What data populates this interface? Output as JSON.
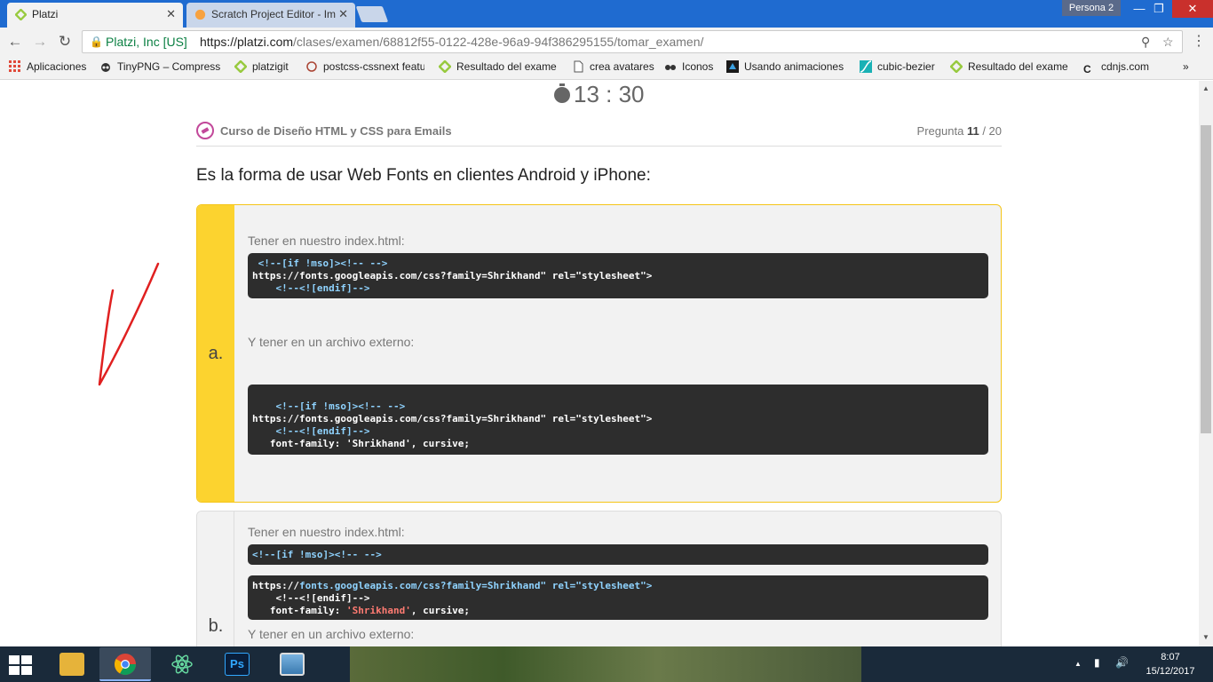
{
  "browser": {
    "tabs": [
      {
        "title": "Platzi",
        "active": true
      },
      {
        "title": "Scratch Project Editor - Im",
        "active": false
      }
    ],
    "profile_label": "Persona 2",
    "window_controls": {
      "minimize": "—",
      "maximize": "❐",
      "close": "✕"
    },
    "nav": {
      "back": "←",
      "forward": "→",
      "reload": "↻"
    },
    "omnibox": {
      "secure_label": "Platzi, Inc [US]",
      "url_host": "https://platzi.com",
      "url_path": "/clases/examen/68812f55-0122-428e-96a9-94f386295155/tomar_examen/"
    },
    "bookmarks": [
      {
        "label": "Aplicaciones",
        "icon": "apps-grid-icon"
      },
      {
        "label": "TinyPNG – Compress",
        "icon": "panda-icon"
      },
      {
        "label": "platzigit",
        "icon": "platzi-icon"
      },
      {
        "label": "postcss-cssnext featu",
        "icon": "postcss-icon"
      },
      {
        "label": "Resultado del exame",
        "icon": "platzi-icon"
      },
      {
        "label": "crea avatares",
        "icon": "page-icon"
      },
      {
        "label": "Iconos",
        "icon": "glasses-icon"
      },
      {
        "label": "Usando animaciones",
        "icon": "mdn-icon"
      },
      {
        "label": "cubic-bezier",
        "icon": "curve-icon"
      },
      {
        "label": "Resultado del exame",
        "icon": "platzi-icon"
      },
      {
        "label": "cdnjs.com",
        "icon": "cdnjs-icon"
      }
    ],
    "bookmarks_more": "»"
  },
  "exam": {
    "timer": "13 : 30",
    "course_title": "Curso de Diseño HTML y CSS para Emails",
    "question_label": "Pregunta",
    "question_current": "11",
    "question_total": "/ 20",
    "question_text": "Es la forma de usar Web Fonts en clientes Android y iPhone:",
    "options": [
      {
        "letter": "a.",
        "text1": "Tener en nuestro index.html:",
        "code1_line1": " <!--[if !mso]><!-- -->",
        "code1_line2": "https://fonts.googleapis.com/css?family=Shrikhand\" rel=\"stylesheet\">",
        "code1_line3": "    <!--<![endif]-->",
        "text2": "Y tener en un archivo externo:",
        "code2_line1": "    <!--[if !mso]><!-- -->",
        "code2_line2": "https://fonts.googleapis.com/css?family=Shrikhand\" rel=\"stylesheet\">",
        "code2_line3": "    <!--<![endif]-->",
        "code2_line4": "   font-family: 'Shrikhand', cursive;"
      },
      {
        "letter": "b.",
        "text1": "Tener en nuestro index.html:",
        "code1_line1": "<!--[if !mso]><!-- -->",
        "code2_line2_a": "https://",
        "code2_line2_b": "fonts.googleapis.com/css?family=Shrikhand\" rel=\"stylesheet\">",
        "code2_line3": "    <!--<![endif]-->",
        "code2_line4_a": "   font-family: ",
        "code2_line4_b": "'Shrikhand'",
        "code2_line4_c": ", cursive;",
        "text2": "Y tener en un archivo externo:"
      }
    ]
  },
  "taskbar": {
    "apps": [
      "file-explorer-icon",
      "chrome-icon",
      "atom-icon",
      "photoshop-icon",
      "photos-icon"
    ],
    "clock_time": "8:07",
    "clock_date": "15/12/2017",
    "tray_chevron": "▲"
  },
  "colors": {
    "chrome_blue": "#1f6bd0",
    "selected_option": "#fcd32f",
    "code_bg": "#2d2d2d",
    "checkmark_red": "#e02020"
  }
}
